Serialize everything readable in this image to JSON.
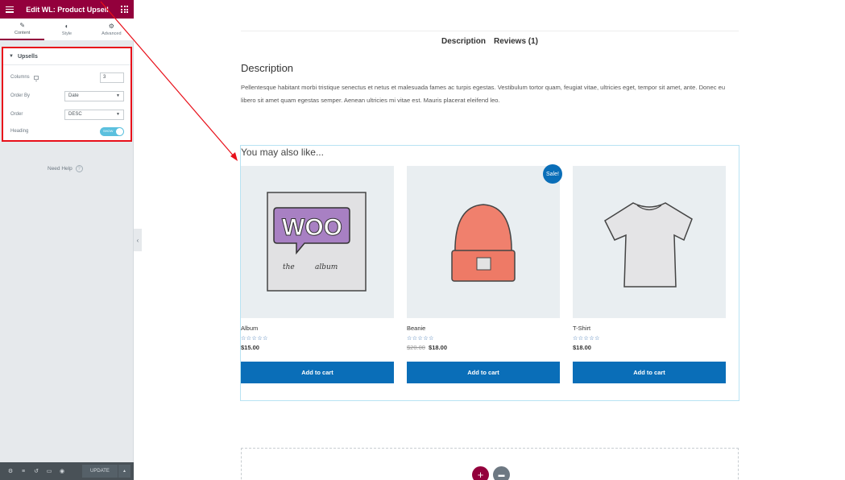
{
  "panel": {
    "title": "Edit WL: Product Upsell",
    "tabs": [
      {
        "label": "Content",
        "icon": "pencil-icon"
      },
      {
        "label": "Style",
        "icon": "half-circle-icon"
      },
      {
        "label": "Advanced",
        "icon": "gear-icon"
      }
    ],
    "section": {
      "title": "Upsells",
      "columns_label": "Columns",
      "columns_value": "3",
      "order_by_label": "Order By",
      "order_by_value": "Date",
      "order_label": "Order",
      "order_value": "DESC",
      "heading_label": "Heading",
      "heading_toggle": "SHOW"
    },
    "need_help": "Need Help",
    "footer": {
      "update_label": "UPDATE"
    }
  },
  "main": {
    "tabs": [
      "Description",
      "Reviews (1)"
    ],
    "description_title": "Description",
    "description_text": "Pellentesque habitant morbi tristique senectus et netus et malesuada fames ac turpis egestas. Vestibulum tortor quam, feugiat vitae, ultricies eget, tempor sit amet, ante. Donec eu libero sit amet quam egestas semper. Aenean ultricies mi vitae est. Mauris placerat eleifend leo.",
    "upsell_heading": "You may also like...",
    "sale_badge": "Sale!",
    "products": [
      {
        "name": "Album",
        "price": "$15.00",
        "old_price": "",
        "button": "Add to cart"
      },
      {
        "name": "Beanie",
        "price": "$18.00",
        "old_price": "$20.00",
        "button": "Add to cart"
      },
      {
        "name": "T-Shirt",
        "price": "$18.00",
        "old_price": "",
        "button": "Add to cart"
      }
    ],
    "stars": "☆☆☆☆☆"
  },
  "colors": {
    "brand": "#93003c",
    "button": "#0a6eb8",
    "highlight": "#e8101a"
  }
}
